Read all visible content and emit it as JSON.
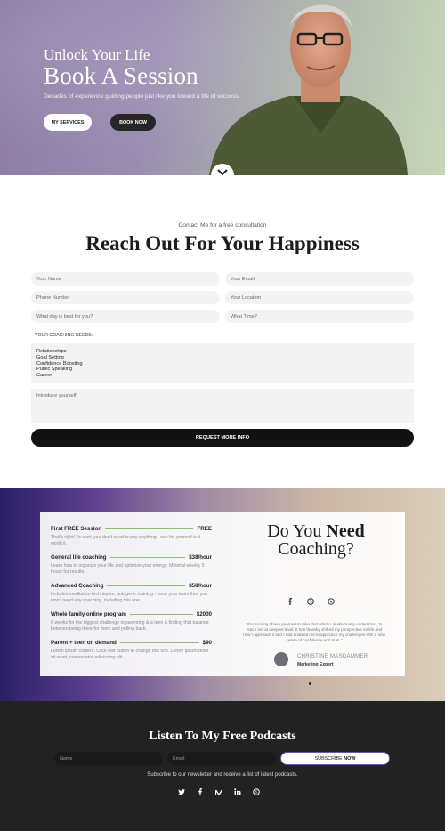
{
  "hero": {
    "script_line": "Unlock Your Life",
    "title": "Book A Session",
    "tagline": "Decades of experience guiding people just like you toward a life of success.",
    "btn_services": "MY SERVICES",
    "btn_book": "BOOK NOW"
  },
  "contact": {
    "kicker": "Contact Me for a free consultation",
    "title_pre": "Reach Out For",
    "title_bold": "Your",
    "title_post": "Happiness",
    "fields": {
      "name": "Your Name",
      "email": "Your Email",
      "phone": "Phone Number",
      "location": "Your Location",
      "day": "What day is best for you?",
      "time": "What Time?"
    },
    "needs_label": "YOUR COACHING NEEDS:",
    "needs": [
      "Relationships",
      "Goal Setting",
      "Confidence Boosting",
      "Public Speaking",
      "Career"
    ],
    "intro_placeholder": "Introduce yourself",
    "submit": "REQUEST MORE INFO"
  },
  "coaching": {
    "prices": [
      {
        "name": "First FREE Session",
        "price": "FREE",
        "desc": "That's right! To start, you don't need to pay anything - see for yourself is it worth it."
      },
      {
        "name": "General life coaching",
        "price": "$38/hour",
        "desc": "Learn how to organize your life and optimize your energy. Minimal weekly 5 hours for results."
      },
      {
        "name": "Advanced Coaching",
        "price": "$58/hour",
        "desc": "Includes meditation techniques, autogenic training - once your team this, you won't need any coaching, including this one."
      },
      {
        "name": "Whole family online program",
        "price": "$2000",
        "desc": "6 weeks for the biggest challenge in parenting & a teen & finding that balance between being there for them and pulling back."
      },
      {
        "name": "Parent + teen on demand",
        "price": "$90",
        "desc": "Lorem ipsum content. Click edit button to change this text. Lorem ipsum dolor sit amet, consectetur adipiscing elit."
      }
    ],
    "need_title_pre": "Do You",
    "need_title_bold": "Need",
    "need_title_post": "Coaching?",
    "social_icons": [
      "facebook-icon",
      "skype-icon",
      "whatsapp-icon"
    ],
    "quote": "\"For so long I have yearned to take that which I intellectually understood, to reach me at deepest level. It has thereby shifted my perspective on life and how I approach it and I had enabled me to approach my challenges with a new sense of confidence and trust.\"",
    "author_name": "CHRISTINE MASDAMMER",
    "author_role": "Marketing Expert"
  },
  "footer": {
    "title_pre": "Listen To My",
    "title_bold": "Free Podcasts",
    "name_placeholder": "Name",
    "email_placeholder": "Email",
    "subscribe_pre": "SUBSCRIBE",
    "subscribe_bold": "NOW",
    "newsletter_text": "Subscribe to our newsletter and receive a list of latest podcasts.",
    "social_icons": [
      "twitter-icon",
      "facebook-icon",
      "medium-icon",
      "linkedin-icon",
      "skype-icon"
    ]
  },
  "colors": {
    "accent_green": "#8bbf78",
    "dark": "#222222",
    "subscribe_border": "#6c5aa8"
  }
}
